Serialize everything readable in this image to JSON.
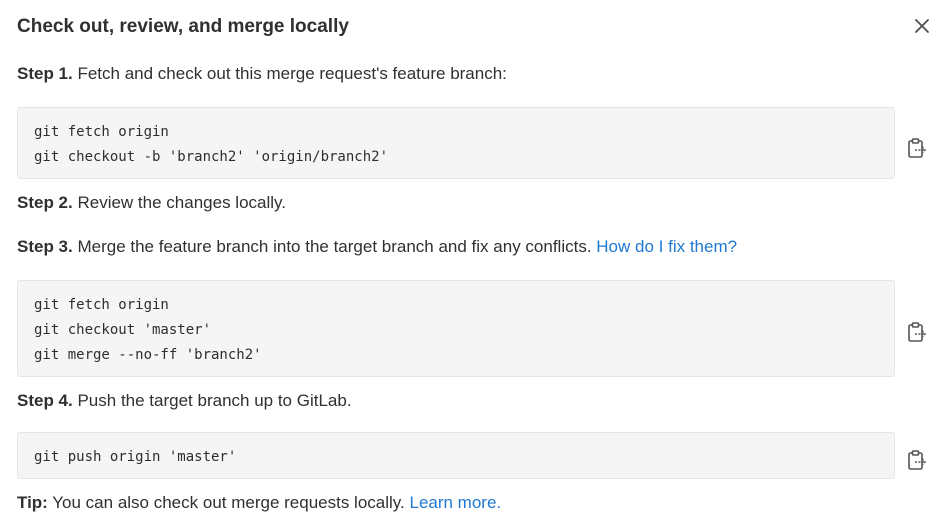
{
  "modal": {
    "title": "Check out, review, and merge locally"
  },
  "step1": {
    "label": "Step 1.",
    "text": " Fetch and check out this merge request's feature branch:",
    "code": [
      "git fetch origin",
      "git checkout -b 'branch2' 'origin/branch2'"
    ]
  },
  "step2": {
    "label": "Step 2.",
    "text": " Review the changes locally."
  },
  "step3": {
    "label": "Step 3.",
    "text": " Merge the feature branch into the target branch and fix any conflicts. ",
    "link": "How do I fix them?",
    "code": [
      "git fetch origin",
      "git checkout 'master'",
      "git merge --no-ff 'branch2'"
    ]
  },
  "step4": {
    "label": "Step 4.",
    "text": " Push the target branch up to GitLab.",
    "code": [
      "git push origin 'master'"
    ]
  },
  "tip": {
    "label": "Tip:",
    "text": " You can also check out merge requests locally. ",
    "link": "Learn more."
  },
  "icons": {
    "close": "close-icon",
    "copy": "clipboard-copy-icon"
  },
  "colors": {
    "link": "#1f78d1",
    "code_bg": "#f5f5f5",
    "text": "#303030"
  }
}
